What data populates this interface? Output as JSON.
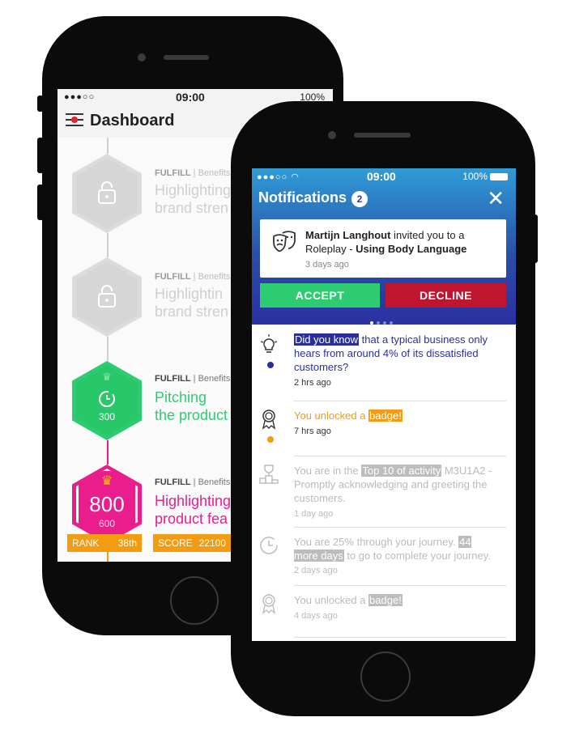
{
  "dashboard": {
    "status": {
      "signal": "●●●○○",
      "time": "09:00",
      "battery": "100%"
    },
    "title": "Dashboard",
    "entries": [
      {
        "category": "FULFILL",
        "sub": "| Benefits",
        "title_line1": "Highlighting",
        "title_line2": "brand stren",
        "state": "locked"
      },
      {
        "category": "FULFILL",
        "sub": "| Benefits",
        "title_line1": "Highlightin",
        "title_line2": "brand stren",
        "state": "locked"
      },
      {
        "category": "FULFILL",
        "sub": "| Benefits",
        "title_line1": "Pitching",
        "title_line2": "the product",
        "state": "done",
        "points": "300"
      },
      {
        "category": "FULFILL",
        "sub": "| Benefits",
        "title_line1": "Highlighting",
        "title_line2": "product fea",
        "state": "current",
        "big": "800",
        "points": "600"
      }
    ],
    "rank_label": "RANK",
    "rank_value": "38th",
    "score_label": "SCORE",
    "score_value": "22100"
  },
  "notifications": {
    "status": {
      "signal": "●●●○○",
      "time": "09:00",
      "battery": "100%"
    },
    "title": "Notifications",
    "count": "2",
    "invite": {
      "sender": "Martijn Langhout",
      "text": " invited you to a Roleplay - ",
      "topic": "Using Body Language",
      "ago": "3 days ago"
    },
    "accept_label": "ACCEPT",
    "decline_label": "DECLINE",
    "feed": [
      {
        "highlight": "Did you know",
        "rest": " that a typical business only hears from around 4% of its dissatisfied customers?",
        "ago": "2 hrs ago"
      },
      {
        "prefix": "You unlocked a ",
        "highlight": "badge!",
        "ago": "7 hrs ago"
      },
      {
        "prefix": "You are in the ",
        "highlight": "Top 10 of activity",
        "rest": " M3U1A2 - Promptly acknowledging and greeting the customers.",
        "ago": "1 day ago"
      },
      {
        "prefix": "You are 25% through your journey. ",
        "highlight": "44 more days",
        "rest": " to go to complete your journey.",
        "ago": "2 days ago"
      },
      {
        "prefix": "You unlocked a ",
        "highlight": "badge!",
        "ago": "4 days ago"
      }
    ],
    "colors": {
      "accent_navy": "#2b2f9a",
      "orange": "#f39c12",
      "accept": "#2ecc71",
      "decline": "#c0152f"
    }
  }
}
